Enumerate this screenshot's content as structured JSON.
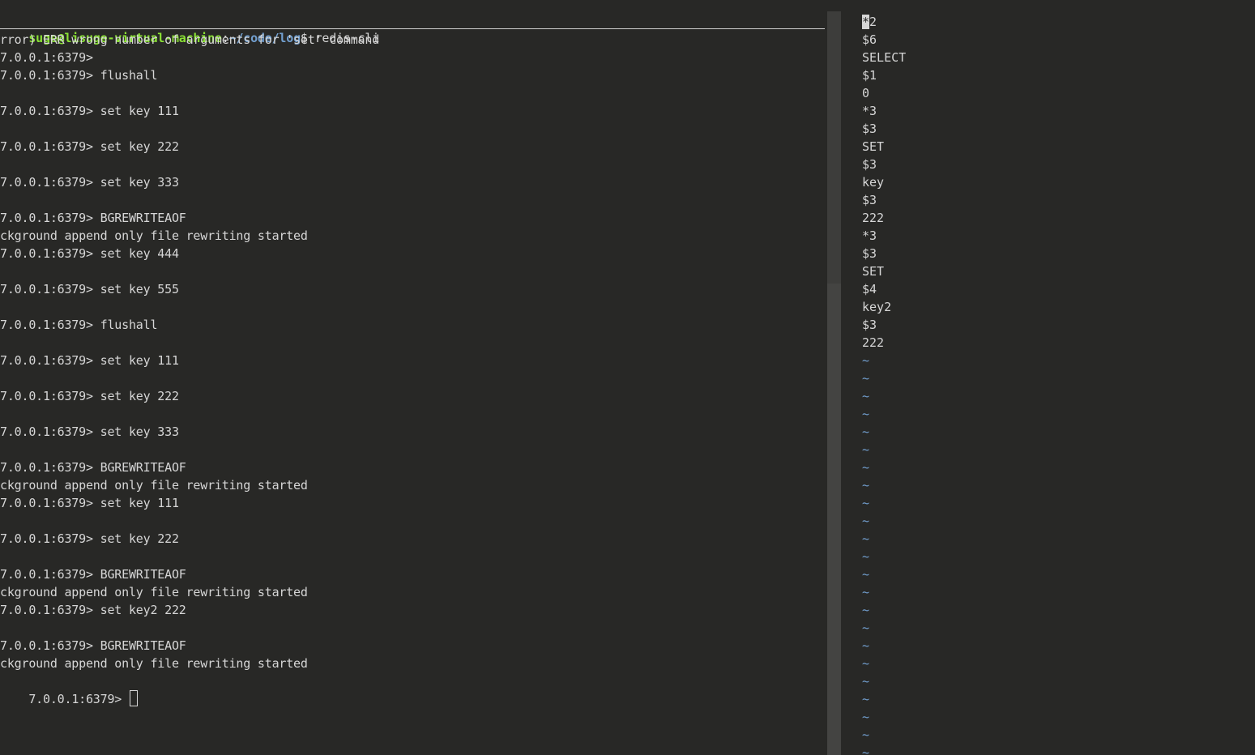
{
  "terminal": {
    "prompt": {
      "user_host": "suge@lisuge-virtual-machine",
      "separator": ":",
      "path": "~/code/log",
      "dollar": "$",
      "command": " redis-cli"
    },
    "lines": [
      "rror) ERR wrong number of arguments for 'set' command",
      "7.0.0.1:6379>",
      "7.0.0.1:6379> flushall",
      "",
      "7.0.0.1:6379> set key 111",
      "",
      "7.0.0.1:6379> set key 222",
      "",
      "7.0.0.1:6379> set key 333",
      "",
      "7.0.0.1:6379> BGREWRITEAOF",
      "ckground append only file rewriting started",
      "7.0.0.1:6379> set key 444",
      "",
      "7.0.0.1:6379> set key 555",
      "",
      "7.0.0.1:6379> flushall",
      "",
      "7.0.0.1:6379> set key 111",
      "",
      "7.0.0.1:6379> set key 222",
      "",
      "7.0.0.1:6379> set key 333",
      "",
      "7.0.0.1:6379> BGREWRITEAOF",
      "ckground append only file rewriting started",
      "7.0.0.1:6379> set key 111",
      "",
      "7.0.0.1:6379> set key 222",
      "",
      "7.0.0.1:6379> BGREWRITEAOF",
      "ckground append only file rewriting started",
      "7.0.0.1:6379> set key2 222",
      "",
      "7.0.0.1:6379> BGREWRITEAOF",
      "ckground append only file rewriting started"
    ],
    "last_prompt": "7.0.0.1:6379> "
  },
  "editor": {
    "first_char": "*",
    "first_rest": "2",
    "lines": [
      "$6",
      "SELECT",
      "$1",
      "0",
      "*3",
      "$3",
      "SET",
      "$3",
      "key",
      "$3",
      "222",
      "*3",
      "$3",
      "SET",
      "$4",
      "key2",
      "$3",
      "222"
    ],
    "empty_marker": "~",
    "empty_count": 23
  },
  "colors": {
    "background": "#282826",
    "text": "#d6d6d6",
    "prompt_user": "#8ae234",
    "prompt_path": "#729fcf",
    "tilde": "#729fcf"
  }
}
